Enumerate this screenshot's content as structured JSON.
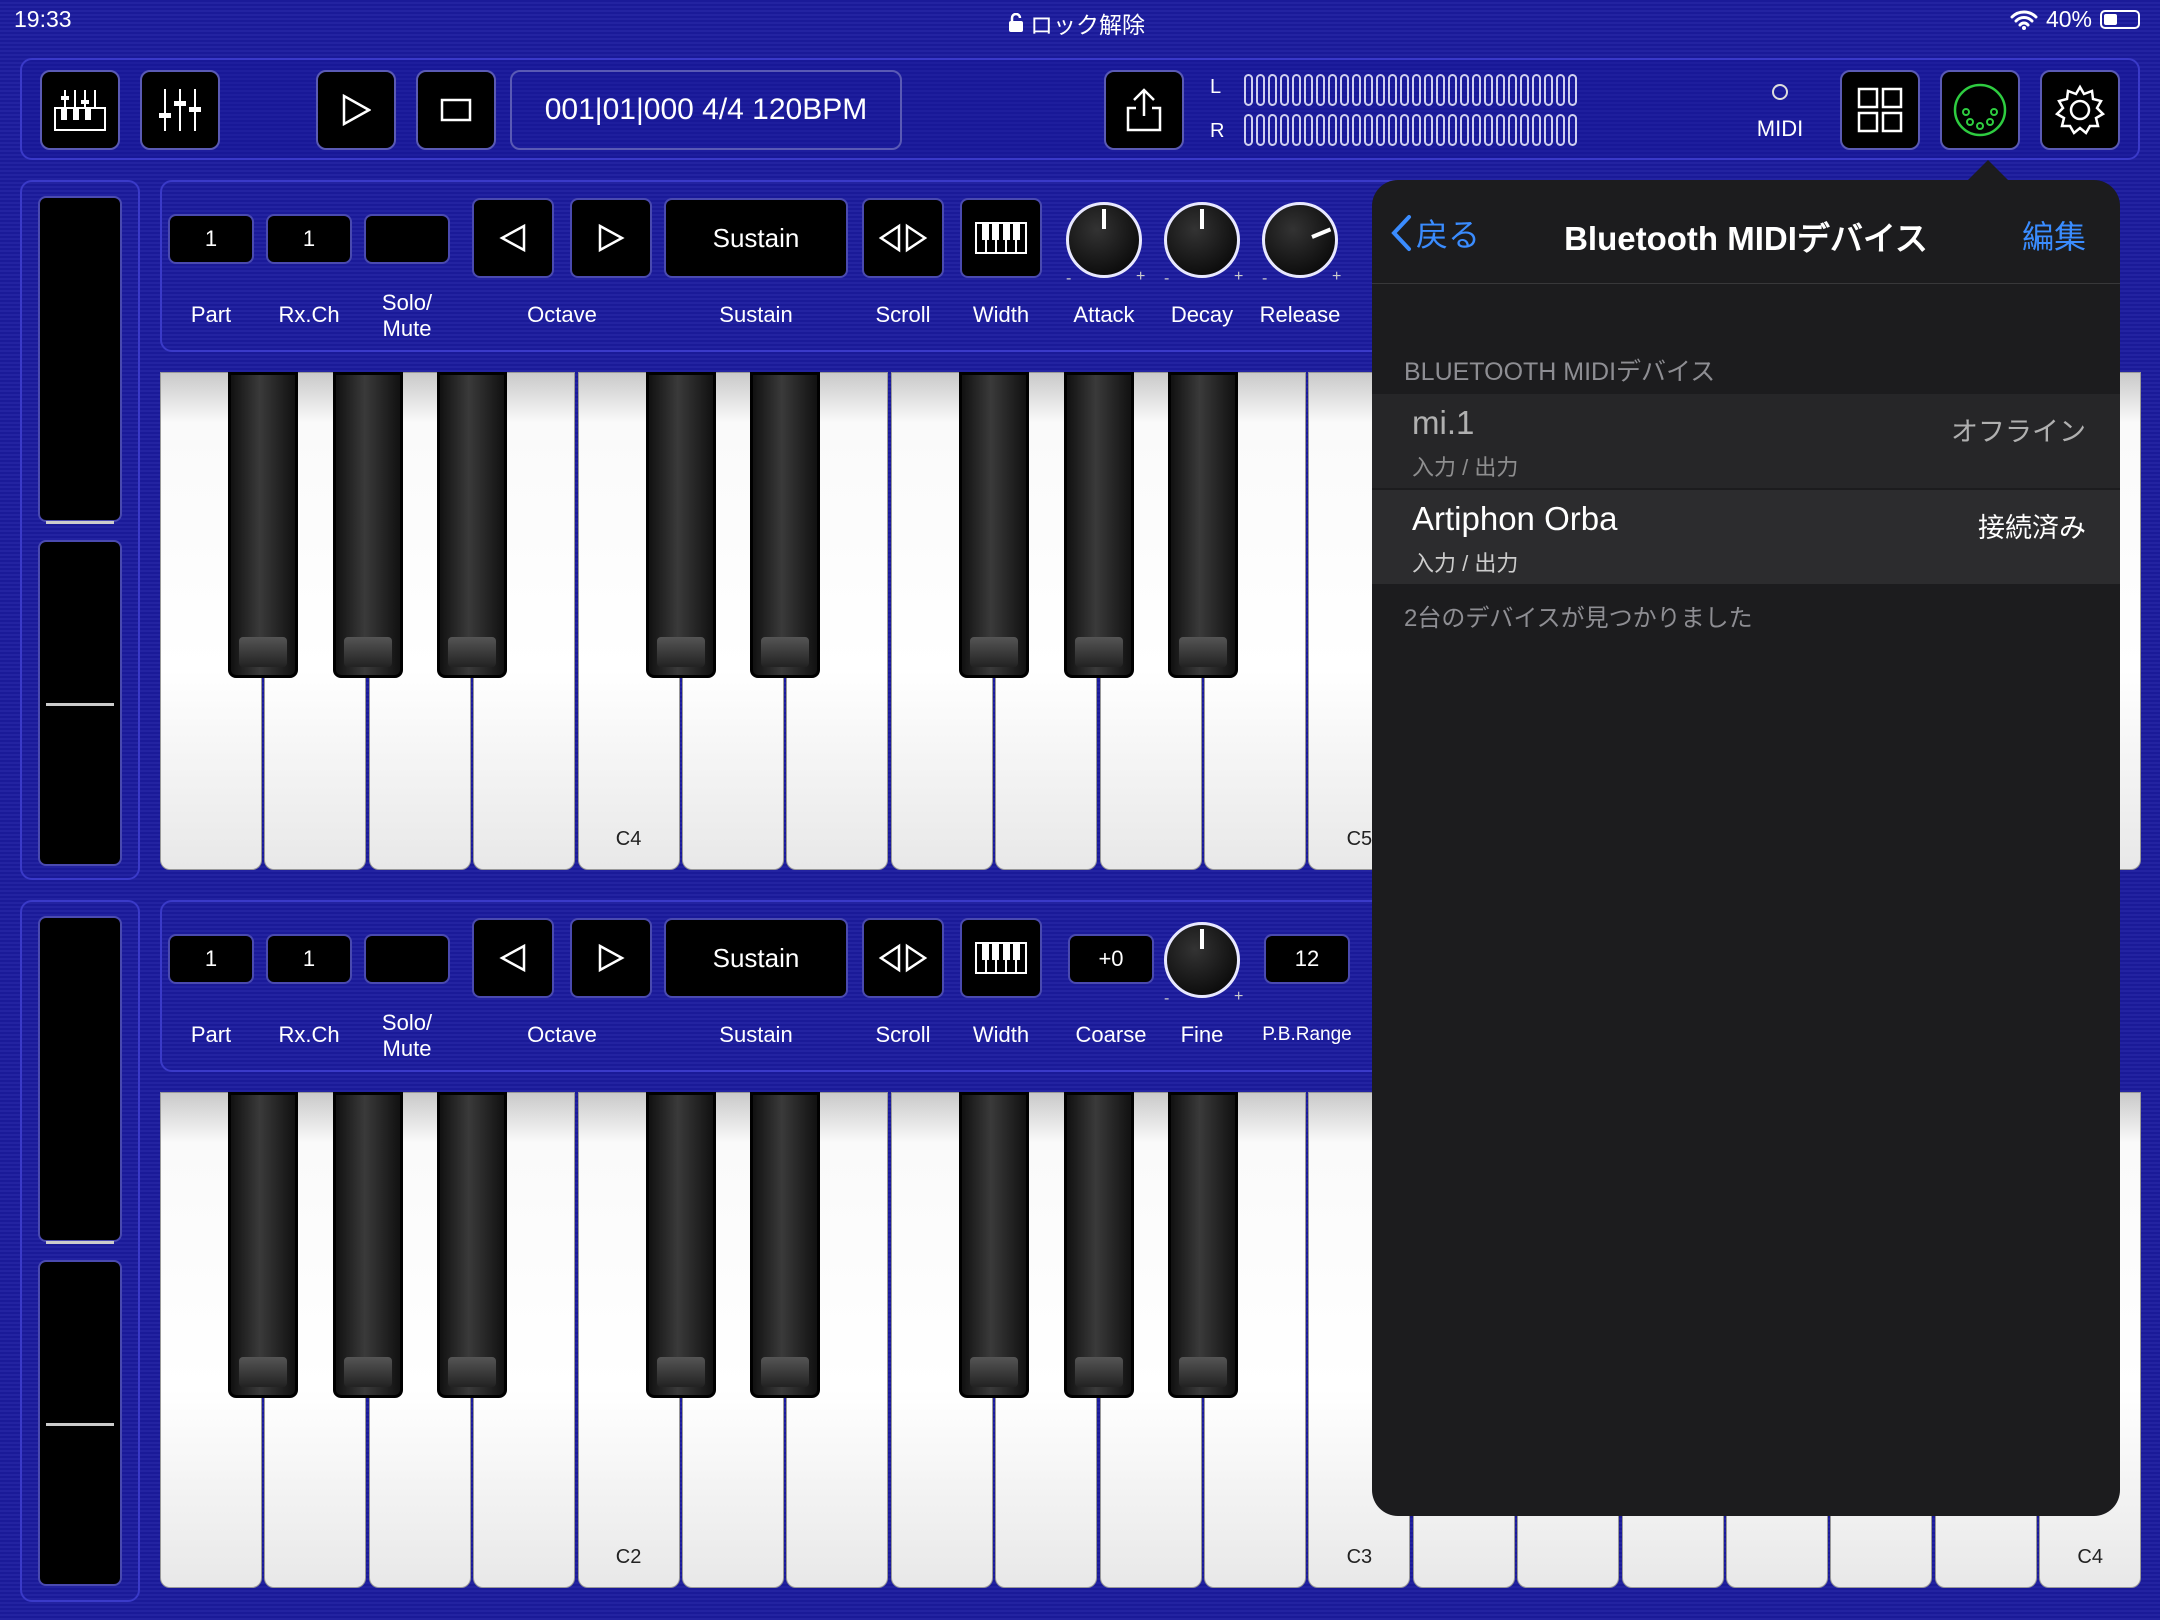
{
  "status": {
    "time": "19:33",
    "lock": "ロック解除",
    "battery": "40%",
    "battery_level": 0.4
  },
  "transport": {
    "position": "001|01|000 4/4 120BPM",
    "midi_label": "MIDI",
    "left_ch": "L",
    "right_ch": "R"
  },
  "part1": {
    "part": "1",
    "rxch": "1",
    "sustain_btn": "Sustain",
    "labels": {
      "part": "Part",
      "rxch": "Rx.Ch",
      "solo": "Solo/",
      "mute": "Mute",
      "octave": "Octave",
      "sustain": "Sustain",
      "scroll": "Scroll",
      "width": "Width",
      "attack": "Attack",
      "decay": "Decay",
      "release": "Release"
    },
    "knobs": {
      "attack": 0.5,
      "decay": 0.5,
      "release": 0.75
    }
  },
  "part2": {
    "part": "1",
    "rxch": "1",
    "sustain_btn": "Sustain",
    "coarse": "+0",
    "pbrange": "12",
    "labels": {
      "part": "Part",
      "rxch": "Rx.Ch",
      "solo": "Solo/",
      "mute": "Mute",
      "octave": "Octave",
      "sustain": "Sustain",
      "scroll": "Scroll",
      "width": "Width",
      "coarse": "Coarse",
      "fine": "Fine",
      "pbrange": "P.B.Range"
    },
    "knobs": {
      "fine": 0.5
    }
  },
  "keyboard1": {
    "notes": [
      "C4",
      "C5"
    ]
  },
  "keyboard2": {
    "notes": [
      "C2",
      "C3",
      "C4"
    ]
  },
  "popover": {
    "back": "戻る",
    "title": "Bluetooth MIDIデバイス",
    "edit": "編集",
    "section": "BLUETOOTH MIDIデバイス",
    "devices": [
      {
        "name": "mi.1",
        "io": "入力 / 出力",
        "status": "オフライン"
      },
      {
        "name": "Artiphon Orba",
        "io": "入力 / 出力",
        "status": "接続済み"
      }
    ],
    "footer": "2台のデバイスが見つかりました"
  },
  "colors": {
    "background": "#1b1b9e",
    "accent": "#3a8cff",
    "midi_green": "#2ecc40"
  }
}
